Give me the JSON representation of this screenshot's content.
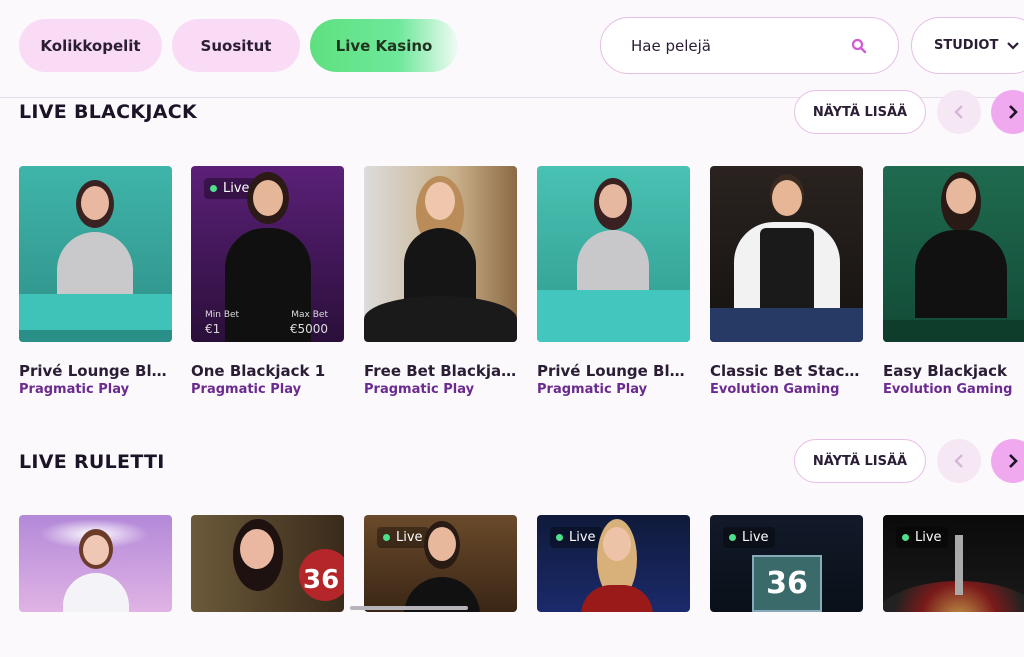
{
  "nav": {
    "tabs": [
      {
        "label": "Kolikkopelit"
      },
      {
        "label": "Suositut"
      },
      {
        "label": "Live Kasino"
      }
    ],
    "search_placeholder": "Hae pelejä",
    "studio_label": "STUDIOT"
  },
  "sections": [
    {
      "title": "LIVE BLACKJACK",
      "more_label": "NÄYTÄ LISÄÄ",
      "games": [
        {
          "name": "Privé Lounge Blac…",
          "provider": "Pragmatic Play"
        },
        {
          "name": "One Blackjack 1",
          "provider": "Pragmatic Play",
          "live": "Live",
          "min_label": "Min Bet",
          "max_label": "Max Bet",
          "min_value": "€1",
          "max_value": "€5000"
        },
        {
          "name": "Free Bet Blackjack",
          "provider": "Pragmatic Play"
        },
        {
          "name": "Privé Lounge Blac…",
          "provider": "Pragmatic Play"
        },
        {
          "name": "Classic Bet Stacke…",
          "provider": "Evolution Gaming"
        },
        {
          "name": "Easy Blackjack",
          "provider": "Evolution Gaming"
        }
      ]
    },
    {
      "title": "LIVE RULETTI",
      "more_label": "NÄYTÄ LISÄÄ",
      "games": [
        {
          "name": "",
          "provider": ""
        },
        {
          "name": "",
          "provider": "",
          "badge": "36"
        },
        {
          "name": "",
          "provider": "",
          "live": "Live"
        },
        {
          "name": "",
          "provider": "",
          "live": "Live"
        },
        {
          "name": "",
          "provider": "",
          "live": "Live",
          "badge": "36"
        },
        {
          "name": "",
          "provider": "",
          "live": "Live"
        }
      ]
    }
  ],
  "colors": {
    "accent_pink": "#f0a8ef",
    "pill_pink": "#fadbf6",
    "live_green": "#5fe080",
    "provider_purple": "#6b2a90"
  },
  "icons": {
    "search": "search-icon",
    "chevron_down": "chevron-down-icon",
    "prev": "chevron-left-icon",
    "next": "chevron-right-icon"
  }
}
